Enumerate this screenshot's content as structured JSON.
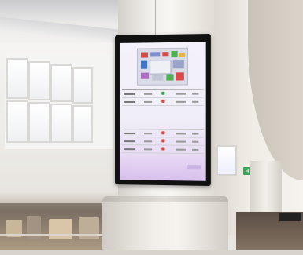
{
  "signage": {
    "title": "",
    "upper_section": {
      "headers": [
        "",
        "",
        ""
      ],
      "rows": [
        {
          "status_color": "#35a853"
        },
        {
          "status_color": "#e0433b"
        }
      ]
    },
    "lower_section": {
      "headers": [
        "",
        "",
        ""
      ],
      "rows": [
        {
          "status_color": "#e0433b"
        },
        {
          "status_color": "#e0433b"
        },
        {
          "status_color": "#e0433b"
        }
      ]
    },
    "accent_colors": {
      "screen_top": "#f4f1fa",
      "screen_bottom": "#d8c0ec",
      "map_red": "#d94a4a",
      "map_green": "#4caf50",
      "map_blue": "#3f74c9",
      "map_yellow": "#e3b53c"
    }
  },
  "environment": {
    "exit_sign_color": "#3aa655"
  }
}
